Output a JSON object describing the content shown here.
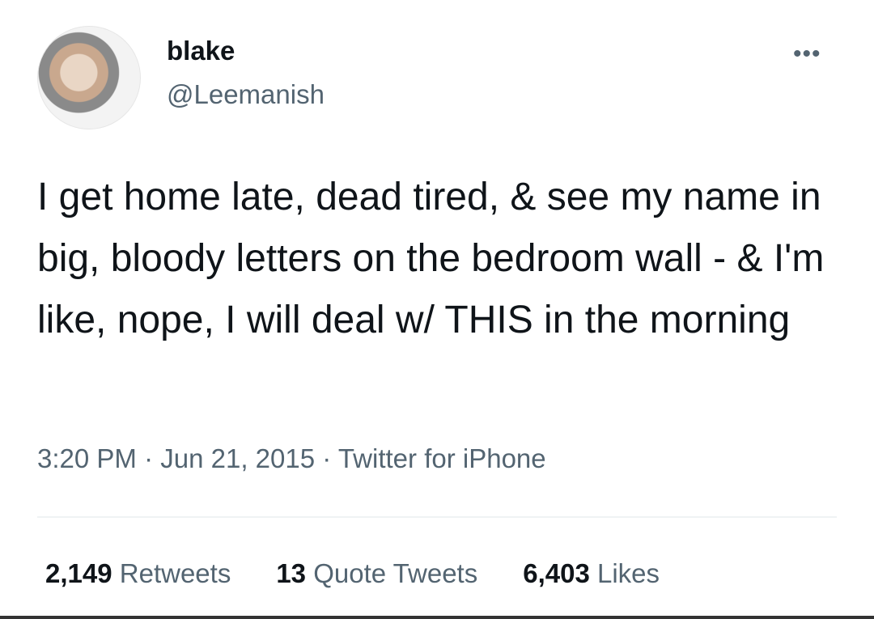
{
  "user": {
    "name": "blake",
    "handle": "@Leemanish"
  },
  "tweet": {
    "text": "I get home late, dead tired, & see my name in big, bloody letters on the bedroom wall - & I'm like, nope, I will deal w/ THIS in the morning",
    "time": "3:20 PM",
    "date": "Jun 21, 2015",
    "source": "Twitter for iPhone",
    "sep": "·"
  },
  "stats": {
    "retweets": "2,149",
    "retweets_label": "Retweets",
    "quotes": "13",
    "quotes_label": "Quote Tweets",
    "likes": "6,403",
    "likes_label": "Likes"
  },
  "icons": {
    "more": "more-dots-icon"
  }
}
